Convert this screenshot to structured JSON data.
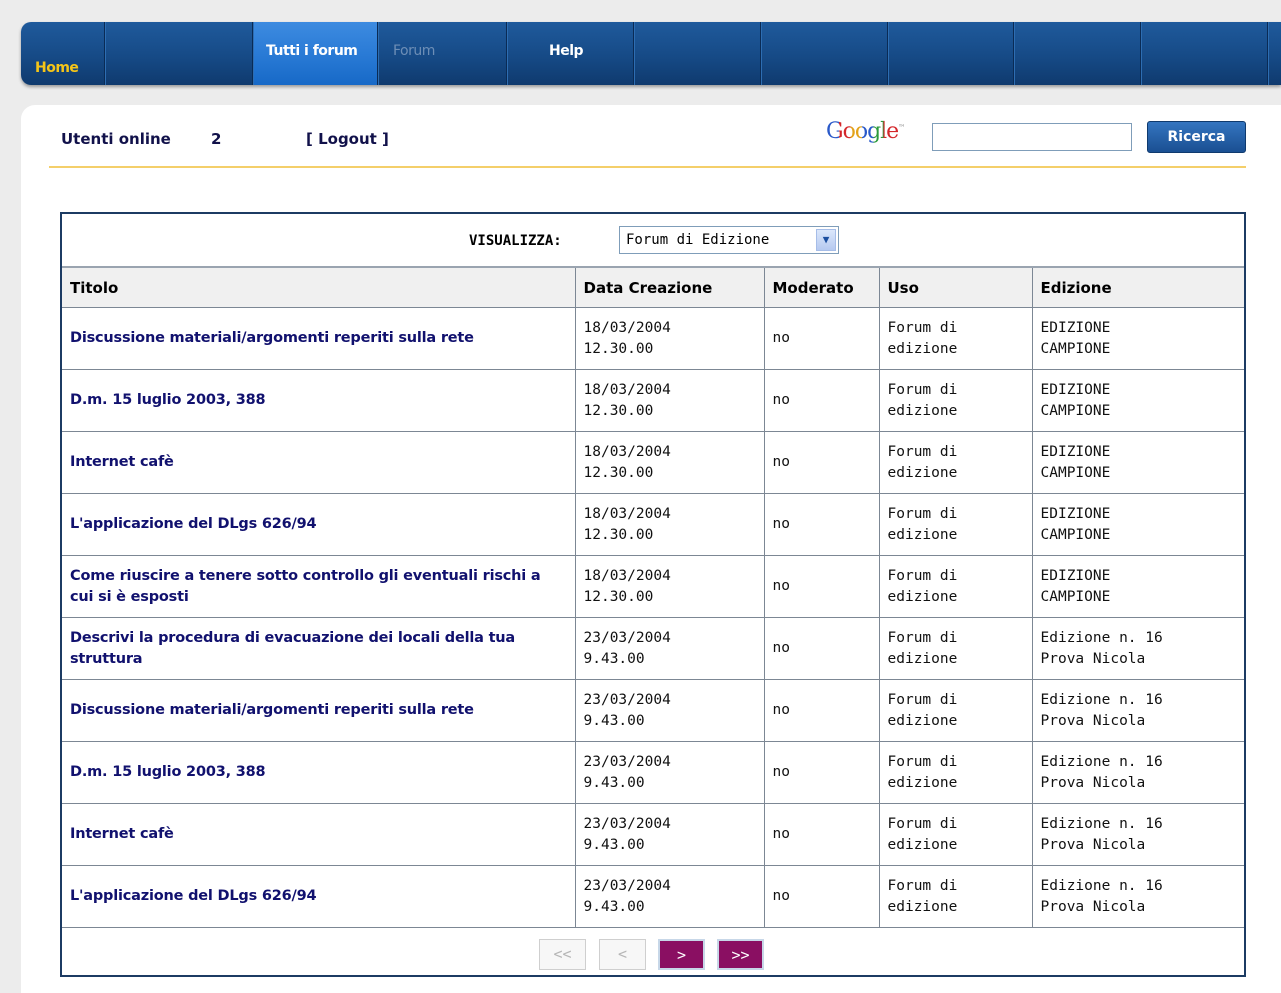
{
  "nav": {
    "items": [
      {
        "label": "Home"
      },
      {
        "label": "Tutti i forum"
      },
      {
        "label": "Forum"
      },
      {
        "label": "Help"
      }
    ]
  },
  "header": {
    "users_online_label": "Utenti online",
    "users_online_count": "2",
    "logout_label": "[ Logout ]",
    "search_brand": "Google",
    "search_value": "",
    "search_button": "Ricerca"
  },
  "filter": {
    "label": "VISUALIZZA:",
    "selected": "Forum di Edizione"
  },
  "table": {
    "columns": [
      "Titolo",
      "Data Creazione",
      "Moderato",
      "Uso",
      "Edizione"
    ],
    "rows": [
      {
        "title": "Discussione materiali/argomenti reperiti sulla rete",
        "date": "18/03/2004",
        "time": "12.30.00",
        "moderated": "no",
        "use1": "Forum di",
        "use2": "edizione",
        "ed1": "EDIZIONE",
        "ed2": "CAMPIONE"
      },
      {
        "title": "D.m. 15 luglio 2003, 388",
        "date": "18/03/2004",
        "time": "12.30.00",
        "moderated": "no",
        "use1": "Forum di",
        "use2": "edizione",
        "ed1": "EDIZIONE",
        "ed2": "CAMPIONE"
      },
      {
        "title": "Internet cafè",
        "date": "18/03/2004",
        "time": "12.30.00",
        "moderated": "no",
        "use1": "Forum di",
        "use2": "edizione",
        "ed1": "EDIZIONE",
        "ed2": "CAMPIONE"
      },
      {
        "title": "L'applicazione del DLgs 626/94",
        "date": "18/03/2004",
        "time": "12.30.00",
        "moderated": "no",
        "use1": "Forum di",
        "use2": "edizione",
        "ed1": "EDIZIONE",
        "ed2": "CAMPIONE"
      },
      {
        "title": "Come riuscire a tenere sotto controllo gli eventuali rischi a cui si è esposti",
        "date": "18/03/2004",
        "time": "12.30.00",
        "moderated": "no",
        "use1": "Forum di",
        "use2": "edizione",
        "ed1": "EDIZIONE",
        "ed2": "CAMPIONE"
      },
      {
        "title": "Descrivi la procedura di evacuazione dei locali della tua struttura",
        "date": "23/03/2004",
        "time": "9.43.00",
        "moderated": "no",
        "use1": "Forum di",
        "use2": "edizione",
        "ed1": "Edizione n. 16",
        "ed2": "Prova Nicola"
      },
      {
        "title": "Discussione materiali/argomenti reperiti sulla rete",
        "date": "23/03/2004",
        "time": "9.43.00",
        "moderated": "no",
        "use1": "Forum di",
        "use2": "edizione",
        "ed1": "Edizione n. 16",
        "ed2": "Prova Nicola"
      },
      {
        "title": "D.m. 15 luglio 2003, 388",
        "date": "23/03/2004",
        "time": "9.43.00",
        "moderated": "no",
        "use1": "Forum di",
        "use2": "edizione",
        "ed1": "Edizione n. 16",
        "ed2": "Prova Nicola"
      },
      {
        "title": "Internet cafè",
        "date": "23/03/2004",
        "time": "9.43.00",
        "moderated": "no",
        "use1": "Forum di",
        "use2": "edizione",
        "ed1": "Edizione n. 16",
        "ed2": "Prova Nicola"
      },
      {
        "title": "L'applicazione del DLgs 626/94",
        "date": "23/03/2004",
        "time": "9.43.00",
        "moderated": "no",
        "use1": "Forum di",
        "use2": "edizione",
        "ed1": "Edizione n. 16",
        "ed2": "Prova Nicola"
      }
    ]
  },
  "pager": {
    "first": "<<",
    "prev": "<",
    "next": ">",
    "last": ">>"
  }
}
